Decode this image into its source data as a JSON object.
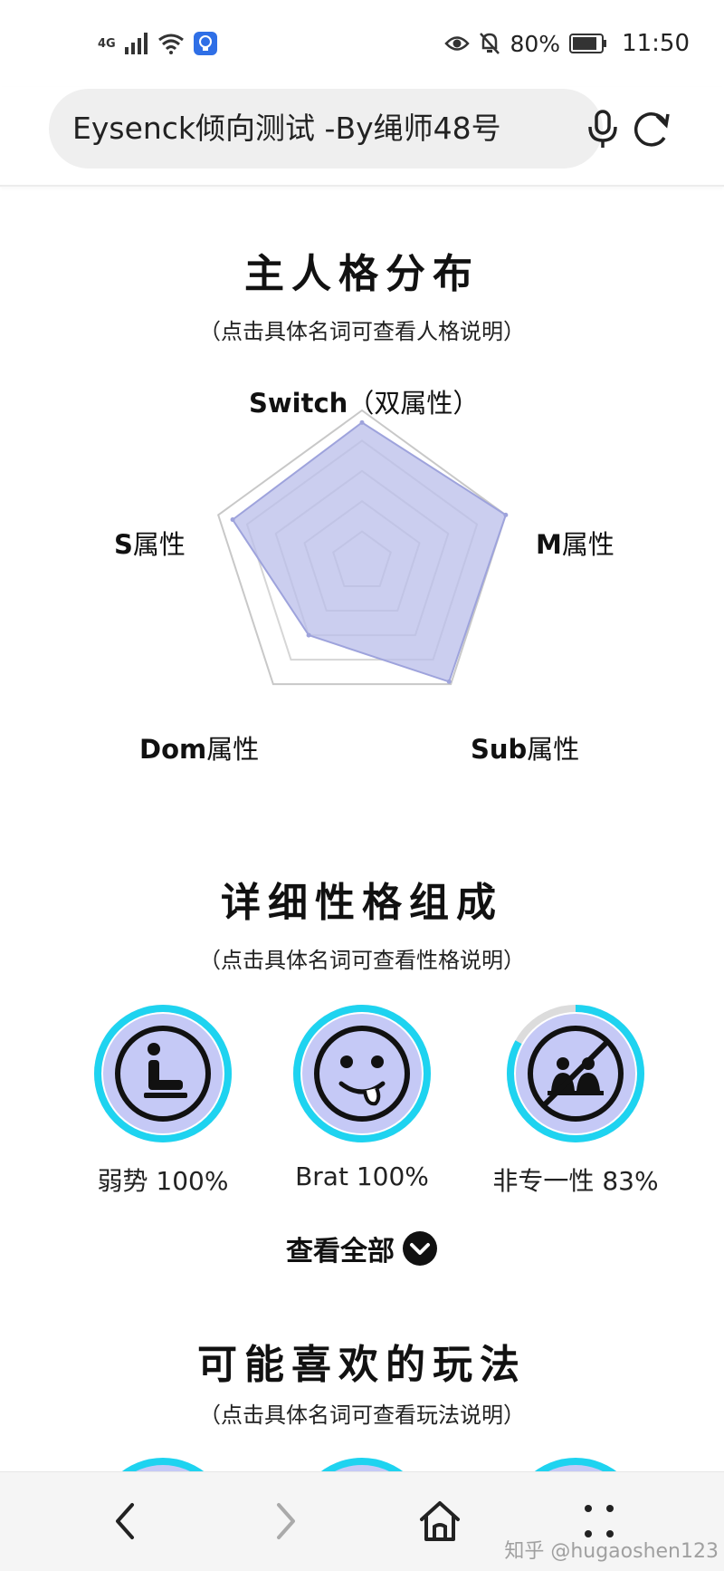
{
  "status_bar": {
    "network_label": "4G",
    "battery_percent": "80%",
    "time": "11:50",
    "icons": [
      "signal-icon",
      "wifi-icon",
      "notification-app-icon",
      "eye-icon",
      "mute-icon",
      "battery-icon"
    ]
  },
  "address_bar": {
    "title": "Eysenck倾向测试 -By绳师48号",
    "icons": [
      "mic-icon",
      "reload-icon"
    ]
  },
  "sections": {
    "main_personality": {
      "title": "主人格分布",
      "subtitle": "（点击具体名词可查看人格说明）"
    },
    "detailed_traits": {
      "title": "详细性格组成",
      "subtitle": "（点击具体名词可查看性格说明）"
    },
    "play_styles": {
      "title": "可能喜欢的玩法",
      "subtitle": "（点击具体名词可查看玩法说明）"
    }
  },
  "chart_data": {
    "type": "radar",
    "axes": [
      {
        "bold": "Switch",
        "suffix": "（双属性）"
      },
      {
        "bold": "M",
        "suffix": "属性"
      },
      {
        "bold": "Sub",
        "suffix": "属性"
      },
      {
        "bold": "Dom",
        "suffix": "属性"
      },
      {
        "bold": "S",
        "suffix": "属性"
      }
    ],
    "values": [
      0.92,
      1.0,
      0.98,
      0.6,
      0.9
    ],
    "range": [
      0,
      1
    ],
    "rings": 5,
    "fill_color": "#b9bde9",
    "stroke_color": "#9ea3dc"
  },
  "traits": [
    {
      "name": "弱势",
      "percent_text": "100%",
      "fraction": 1.0,
      "icon": "sitting-person-icon"
    },
    {
      "name": "Brat",
      "percent_text": "100%",
      "fraction": 1.0,
      "icon": "tongue-out-face-icon"
    },
    {
      "name": "非专一性",
      "percent_text": "83%",
      "fraction": 0.83,
      "icon": "no-couple-icon"
    }
  ],
  "view_all": {
    "label": "查看全部",
    "icon": "chevron-down-circle-icon"
  },
  "bottom_nav": {
    "icons": [
      "back-icon",
      "forward-icon",
      "home-icon",
      "menu-dots-icon"
    ]
  },
  "watermark": "知乎 @hugaoshen123",
  "colors": {
    "ring": "#1ed3f0",
    "ring_track": "#dcdcdc",
    "icon_fill": "#c5c9f6"
  }
}
